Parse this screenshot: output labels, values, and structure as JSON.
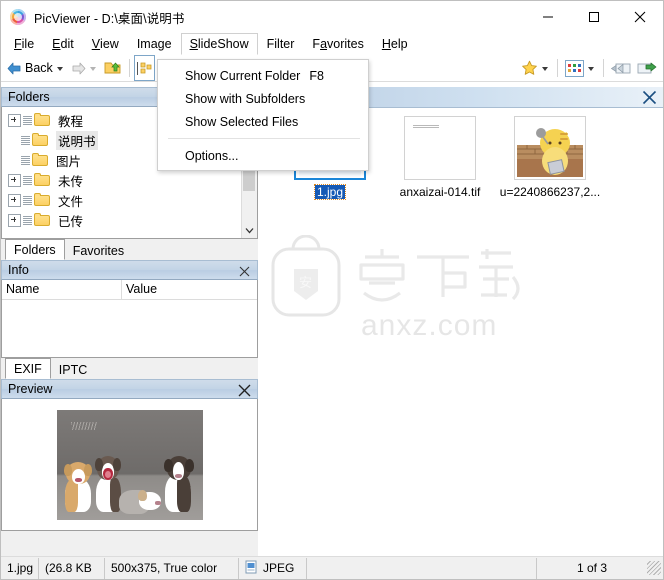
{
  "window": {
    "title": "PicViewer - D:\\桌面\\说明书",
    "icon": "picviewer-logo-icon",
    "buttons": {
      "minimize": "minimize-icon",
      "maximize": "maximize-icon",
      "close": "close-icon"
    }
  },
  "menubar": {
    "items": [
      {
        "label": "File",
        "accel": "F",
        "open": false
      },
      {
        "label": "Edit",
        "accel": "E",
        "open": false
      },
      {
        "label": "View",
        "accel": "V",
        "open": false
      },
      {
        "label": "Image",
        "accel": "",
        "open": false
      },
      {
        "label": "SlideShow",
        "accel": "S",
        "open": true
      },
      {
        "label": "Filter",
        "accel": "",
        "open": false
      },
      {
        "label": "Favorites",
        "accel": "a",
        "open": false
      },
      {
        "label": "Help",
        "accel": "H",
        "open": false
      }
    ]
  },
  "dropdown": {
    "owner": "SlideShow",
    "items": [
      {
        "label": "Show Current Folder",
        "shortcut": "F8",
        "separator_after": false
      },
      {
        "label": "Show with Subfolders",
        "shortcut": "",
        "separator_after": false
      },
      {
        "label": "Show Selected Files",
        "shortcut": "",
        "separator_after": true
      },
      {
        "label": "Options...",
        "shortcut": "",
        "separator_after": false
      }
    ]
  },
  "toolbar": {
    "back_label": "Back",
    "items": [
      "back-button",
      "back-dropdown-caret",
      "forward-button",
      "forward-dropdown-caret",
      "open-folder-icon",
      "folder-tree-icon",
      "favorites-star-icon",
      "favorites-dropdown-caret",
      "thumbnail-view-icon",
      "view-dropdown-caret",
      "previous-image-icon",
      "next-image-icon"
    ]
  },
  "sidebar": {
    "folders_panel": {
      "title": "Folders",
      "close_icon": "close-icon",
      "tree": [
        {
          "label": "教程",
          "expandable": true,
          "selected": false
        },
        {
          "label": "说明书",
          "expandable": false,
          "selected": true
        },
        {
          "label": "图片",
          "expandable": false,
          "selected": false
        },
        {
          "label": "未传",
          "expandable": true,
          "selected": false
        },
        {
          "label": "文件",
          "expandable": true,
          "selected": false
        },
        {
          "label": "已传",
          "expandable": true,
          "selected": false
        }
      ],
      "scrollbar": {
        "down_icon": "chevron-down-icon"
      }
    },
    "folder_tabs": [
      {
        "label": "Folders",
        "active": true
      },
      {
        "label": "Favorites",
        "active": false
      }
    ],
    "info_panel": {
      "title": "Info",
      "close_icon": "close-icon",
      "columns": [
        "Name",
        "Value"
      ],
      "rows": []
    },
    "info_tabs": [
      {
        "label": "EXIF",
        "active": true
      },
      {
        "label": "IPTC",
        "active": false
      }
    ],
    "preview_panel": {
      "title": "Preview",
      "close_icon": "close-icon",
      "image_alt": "five-puppies-photo"
    }
  },
  "main": {
    "close_icon": "close-icon",
    "thumbnails": [
      {
        "caption": "1.jpg",
        "selected": true,
        "kind": "jpg-gradient"
      },
      {
        "caption": "anxaizai-014.tif",
        "selected": false,
        "kind": "tif-document"
      },
      {
        "caption": "u=2240866237,2...",
        "selected": false,
        "kind": "cat-picture"
      }
    ],
    "watermark": {
      "cn": "安下载",
      "url": "anxz.com"
    }
  },
  "statusbar": {
    "filename": "1.jpg",
    "filesize": "(26.8 KB",
    "dimensions": "500x375, True color",
    "format_icon": "jpeg-file-icon",
    "format": "JPEG",
    "empty": "",
    "counter": "1 of 3",
    "resize_grip": "resize-grip-icon"
  }
}
